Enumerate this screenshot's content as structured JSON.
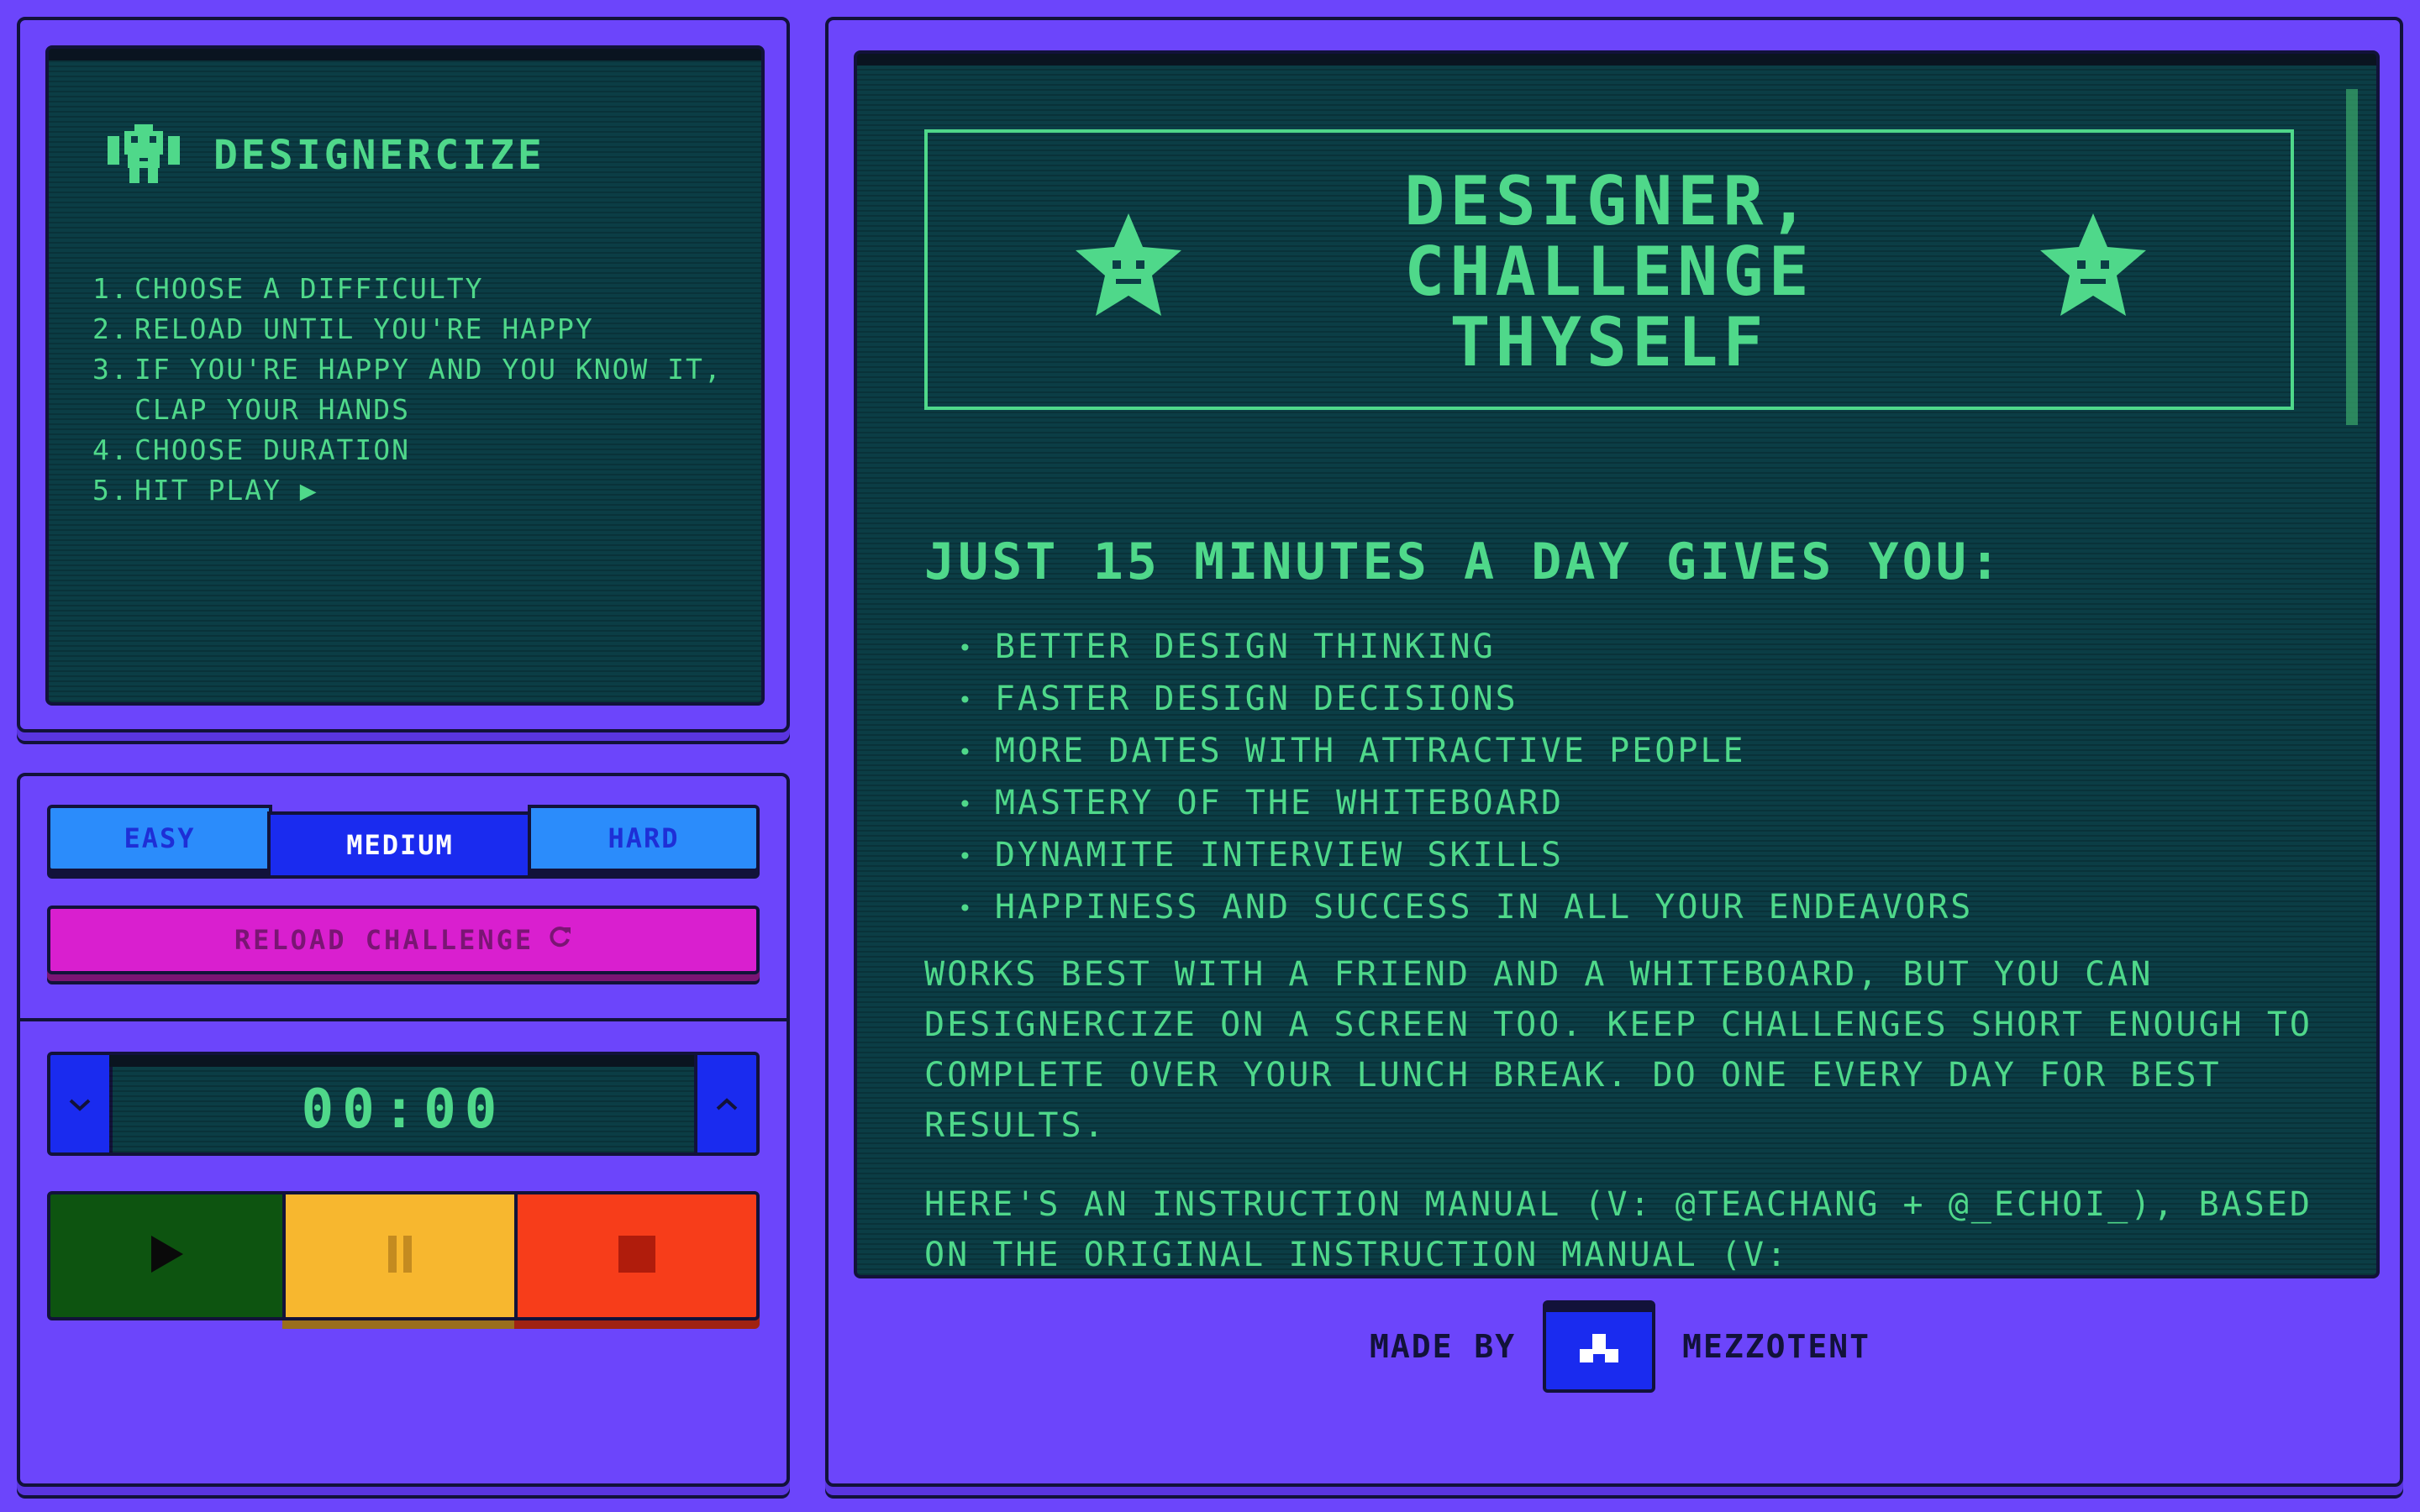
{
  "colors": {
    "background": "#6c45fb",
    "screen": "#0b3d45",
    "text_green": "#4fd88a",
    "dark": "#12123a",
    "magenta": "#d91fcf",
    "blue": "#1a2bef",
    "light_blue": "#2b8cfb",
    "play": "#0d5410",
    "pause": "#f7b72f",
    "stop": "#f73d1a"
  },
  "instructions": {
    "brand": "DESIGNERCIZE",
    "brand_icon": "robot-icon",
    "steps": [
      {
        "num": "1.",
        "text": "CHOOSE A DIFFICULTY"
      },
      {
        "num": "2.",
        "text": "RELOAD UNTIL YOU'RE HAPPY"
      },
      {
        "num": "3.",
        "text": "IF YOU'RE HAPPY AND YOU KNOW IT, CLAP YOUR HANDS"
      },
      {
        "num": "4.",
        "text": "CHOOSE DURATION"
      },
      {
        "num": "5.",
        "text": "HIT PLAY ▶"
      }
    ]
  },
  "difficulty": {
    "easy": "EASY",
    "medium": "MEDIUM",
    "hard": "HARD",
    "selected": "MEDIUM"
  },
  "reload": {
    "label": "RELOAD CHALLENGE",
    "icon": "refresh-icon"
  },
  "timer": {
    "value": "00:00",
    "down_icon": "chevron-down-icon",
    "up_icon": "chevron-up-icon"
  },
  "transport": {
    "play_icon": "play-icon",
    "pause_icon": "pause-icon",
    "stop_icon": "stop-icon"
  },
  "content": {
    "hero_title_lines": [
      "DESIGNER,",
      "CHALLENGE",
      "THYSELF"
    ],
    "hero_icon": "wizard-star-icon",
    "subtitle": "JUST 15 MINUTES A DAY GIVES YOU:",
    "benefits": [
      "BETTER DESIGN THINKING",
      "FASTER DESIGN DECISIONS",
      "MORE DATES WITH ATTRACTIVE PEOPLE",
      "MASTERY OF THE WHITEBOARD",
      "DYNAMITE INTERVIEW SKILLS",
      "HAPPINESS AND SUCCESS IN ALL YOUR ENDEAVORS"
    ],
    "paragraph1": "WORKS BEST WITH A FRIEND AND A WHITEBOARD, BUT YOU CAN DESIGNERCIZE ON A SCREEN TOO. KEEP CHALLENGES SHORT ENOUGH TO COMPLETE OVER YOUR LUNCH BREAK. DO ONE EVERY DAY FOR BEST RESULTS.",
    "paragraph2": "HERE'S AN INSTRUCTION MANUAL (V: @TEACHANG + @_ECHOI_), BASED ON THE ORIGINAL INSTRUCTION MANUAL (V:"
  },
  "footer": {
    "made_by": "MADE BY",
    "company": "MEZZOTENT",
    "logo_icon": "mezzotent-logo-icon"
  }
}
